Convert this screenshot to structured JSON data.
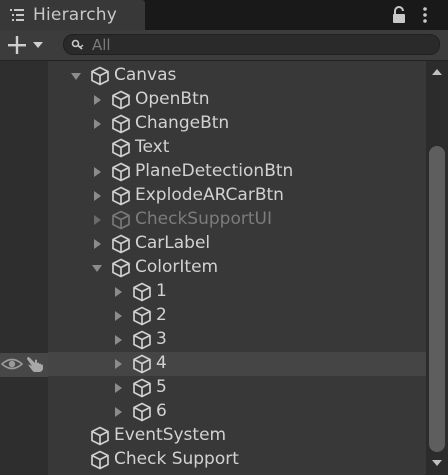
{
  "window": {
    "tab_title": "Hierarchy",
    "tab_icon": "hierarchy-list-icon",
    "lock_icon": "lock-icon",
    "menu_icon": "kebab-menu-icon"
  },
  "toolbar": {
    "add_icon": "plus-dropdown-icon",
    "search_placeholder": "All",
    "search_value": ""
  },
  "tree": {
    "nodes": [
      {
        "label": "Canvas",
        "icon": "gameobject-cube-icon",
        "foldout": "expanded",
        "disabled": false
      },
      {
        "label": "OpenBtn",
        "icon": "gameobject-cube-icon",
        "foldout": "collapsed",
        "disabled": false
      },
      {
        "label": "ChangeBtn",
        "icon": "gameobject-cube-icon",
        "foldout": "collapsed",
        "disabled": false
      },
      {
        "label": "Text",
        "icon": "gameobject-cube-icon",
        "foldout": "none",
        "disabled": false
      },
      {
        "label": "PlaneDetectionBtn",
        "icon": "gameobject-cube-icon",
        "foldout": "collapsed",
        "disabled": false
      },
      {
        "label": "ExplodeARCarBtn",
        "icon": "gameobject-cube-icon",
        "foldout": "collapsed",
        "disabled": false
      },
      {
        "label": "CheckSupportUI",
        "icon": "gameobject-cube-icon",
        "foldout": "collapsed",
        "disabled": true
      },
      {
        "label": "CarLabel",
        "icon": "gameobject-cube-icon",
        "foldout": "collapsed",
        "disabled": false
      },
      {
        "label": "ColorItem",
        "icon": "gameobject-cube-icon",
        "foldout": "expanded",
        "disabled": false
      },
      {
        "label": "1",
        "icon": "gameobject-cube-icon",
        "foldout": "collapsed",
        "disabled": false
      },
      {
        "label": "2",
        "icon": "gameobject-cube-icon",
        "foldout": "collapsed",
        "disabled": false
      },
      {
        "label": "3",
        "icon": "gameobject-cube-icon",
        "foldout": "collapsed",
        "disabled": false
      },
      {
        "label": "4",
        "icon": "gameobject-cube-icon",
        "foldout": "collapsed",
        "disabled": false
      },
      {
        "label": "5",
        "icon": "gameobject-cube-icon",
        "foldout": "collapsed",
        "disabled": false
      },
      {
        "label": "6",
        "icon": "gameobject-cube-icon",
        "foldout": "collapsed",
        "disabled": false
      },
      {
        "label": "EventSystem",
        "icon": "gameobject-cube-icon",
        "foldout": "none",
        "disabled": false
      },
      {
        "label": "Check Support",
        "icon": "gameobject-cube-icon",
        "foldout": "none",
        "disabled": false
      }
    ]
  },
  "gutter": {
    "visibility_icon": "eye-icon",
    "pickable_icon": "hand-pointer-icon"
  },
  "colors": {
    "panel_bg": "#383838",
    "tab_bar_bg": "#191919",
    "gutter_bg": "#2e2e2e",
    "text": "#d2d2d2",
    "disabled_text": "#7c7c7c",
    "hover_row": "#454545",
    "scroll_thumb": "#5e5e5e"
  }
}
